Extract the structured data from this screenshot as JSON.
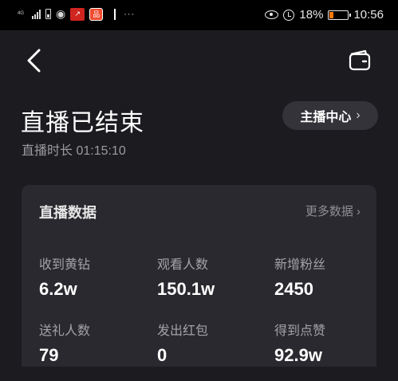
{
  "status_bar": {
    "network": "4G",
    "app_red_label": "↗",
    "app_orange_label": "品",
    "dots": "···",
    "battery_percent": "18%",
    "battery_level": 0.18,
    "time": "10:56"
  },
  "header": {
    "title": "直播已结束",
    "duration": "直播时长 01:15:10",
    "anchor_center_label": "主播中心",
    "chevron": "›"
  },
  "card": {
    "title": "直播数据",
    "more_label": "更多数据",
    "chevron": "›",
    "stats": [
      {
        "label": "收到黄钻",
        "value": "6.2w"
      },
      {
        "label": "观看人数",
        "value": "150.1w"
      },
      {
        "label": "新增粉丝",
        "value": "2450"
      },
      {
        "label": "送礼人数",
        "value": "79"
      },
      {
        "label": "发出红包",
        "value": "0"
      },
      {
        "label": "得到点赞",
        "value": "92.9w"
      }
    ]
  },
  "colors": {
    "background": "#1c1b20",
    "card": "#2a292f",
    "button": "#34333a",
    "battery": "#ff7a00"
  }
}
